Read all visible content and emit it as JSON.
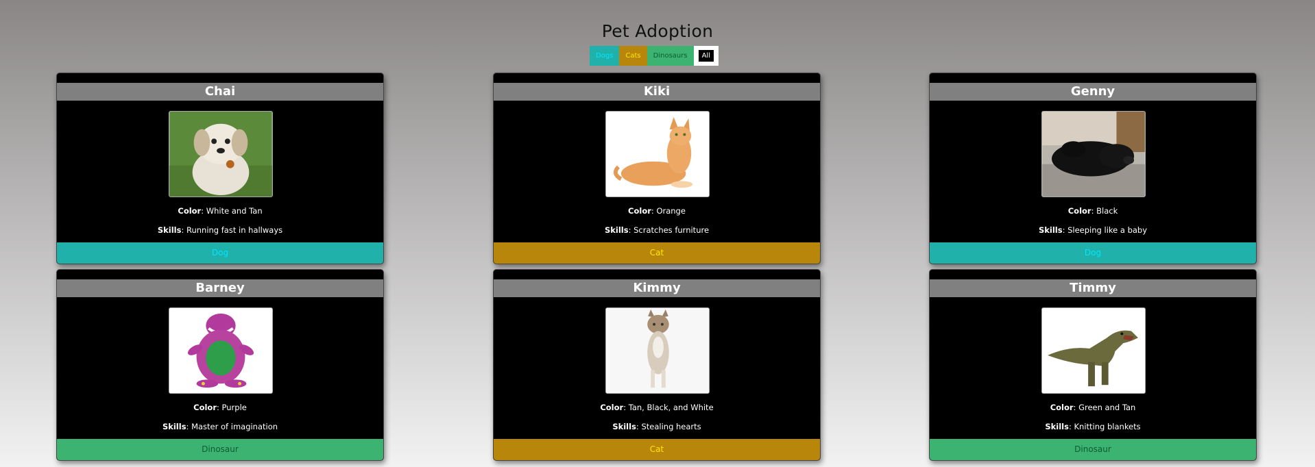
{
  "page": {
    "title": "Pet Adoption"
  },
  "filters": [
    {
      "label": "Dogs"
    },
    {
      "label": "Cats"
    },
    {
      "label": "Dinosaurs"
    },
    {
      "label": "All"
    }
  ],
  "labels": {
    "color": "Color",
    "skills": "Skills"
  },
  "pets": [
    {
      "name": "Chai",
      "color": "White and Tan",
      "skills": "Running fast in hallways",
      "type": "Dog",
      "image_icon": "dog-photo-icon"
    },
    {
      "name": "Kiki",
      "color": "Orange",
      "skills": "Scratches furniture",
      "type": "Cat",
      "image_icon": "cat-photo-icon"
    },
    {
      "name": "Genny",
      "color": "Black",
      "skills": "Sleeping like a baby",
      "type": "Dog",
      "image_icon": "dog-photo-icon"
    },
    {
      "name": "Barney",
      "color": "Purple",
      "skills": "Master of imagination",
      "type": "Dinosaur",
      "image_icon": "dinosaur-photo-icon"
    },
    {
      "name": "Kimmy",
      "color": "Tan, Black, and White",
      "skills": "Stealing hearts",
      "type": "Cat",
      "image_icon": "cat-photo-icon"
    },
    {
      "name": "Timmy",
      "color": "Green and Tan",
      "skills": "Knitting blankets",
      "type": "Dinosaur",
      "image_icon": "dinosaur-photo-icon"
    }
  ],
  "colors": {
    "dog": "#20b2aa",
    "cat": "#b8860b",
    "dinosaur": "#3cb371",
    "card_bg": "#000000",
    "name_bar": "#808080"
  }
}
